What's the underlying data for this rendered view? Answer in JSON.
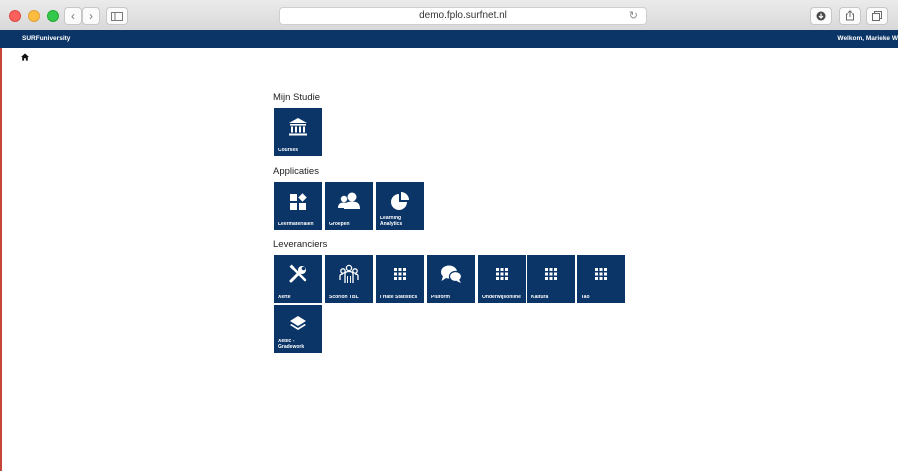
{
  "browser": {
    "url": "demo.fplo.surfnet.nl"
  },
  "header": {
    "brand": "SURFuniversity",
    "welcome": "Welkom, Marieke W"
  },
  "sections": {
    "mijn_studie": {
      "title": "Mijn Studie",
      "tiles": [
        {
          "label": "Courses",
          "icon": "bank-icon"
        }
      ]
    },
    "applicaties": {
      "title": "Applicaties",
      "tiles": [
        {
          "label": "Leermaterialen",
          "icon": "widgets-icon"
        },
        {
          "label": "Groepen",
          "icon": "users-icon"
        },
        {
          "label": "Learning\nAnalytics",
          "icon": "pie-chart-icon"
        }
      ]
    },
    "leveranciers": {
      "title": "Leveranciers",
      "tiles": [
        {
          "label": "Xerte",
          "icon": "tools-icon"
        },
        {
          "label": "Scorion TBL",
          "icon": "team-icon"
        },
        {
          "label": "I Hate Statistics",
          "icon": "grid-icon"
        },
        {
          "label": "Pluform",
          "icon": "chat-icon"
        },
        {
          "label": "Onderwijsonline",
          "icon": "grid-icon"
        },
        {
          "label": "Kaltura",
          "icon": "grid-icon"
        },
        {
          "label": "Tao",
          "icon": "grid-icon"
        },
        {
          "label": "Xebic -\nGradework",
          "icon": "layers-icon"
        }
      ]
    }
  },
  "colors": {
    "brand_navy": "#0b3567",
    "tile_text": "#ffffff"
  }
}
